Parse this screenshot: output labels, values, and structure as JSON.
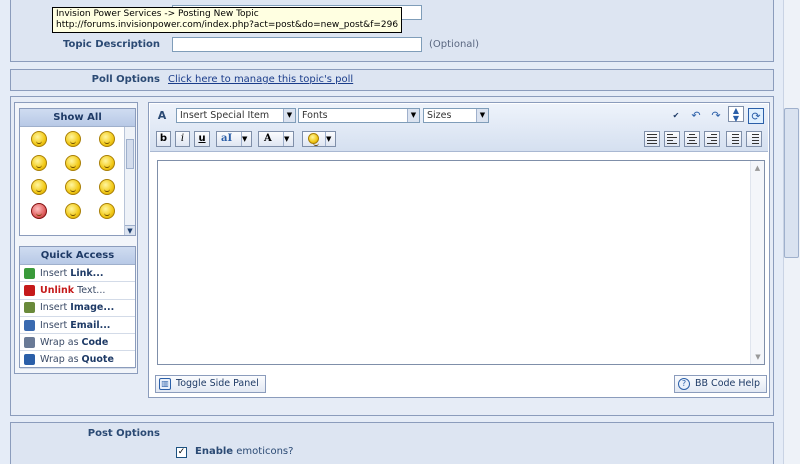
{
  "tooltip": {
    "title": "Invision Power Services -> Posting New Topic",
    "url": "http://forums.invisionpower.com/index.php?act=post&do=new_post&f=296"
  },
  "form": {
    "topic_description_label": "Topic Description",
    "topic_description_value": "",
    "optional_text": "(Optional)",
    "poll_label": "Poll Options",
    "poll_link": "Click here to manage this topic's poll"
  },
  "side_panel": {
    "emoticons_header": "Show All",
    "quick_access_header": "Quick Access",
    "quick_access": [
      {
        "prefix": "Insert ",
        "bold": "Link...",
        "suffix": "",
        "icon": "link-icon",
        "color": "#3a9a3a"
      },
      {
        "prefix": "",
        "bold": "Unlink",
        "suffix": " Text...",
        "icon": "unlink-icon",
        "color": "#c51a1a"
      },
      {
        "prefix": "Insert ",
        "bold": "Image...",
        "suffix": "",
        "icon": "image-icon",
        "color": "#6a8a3a"
      },
      {
        "prefix": "Insert ",
        "bold": "Email...",
        "suffix": "",
        "icon": "email-icon",
        "color": "#3a6ab0"
      },
      {
        "prefix": "Wrap as ",
        "bold": "Code",
        "suffix": "",
        "icon": "code-icon",
        "color": "#6a7a96"
      },
      {
        "prefix": "Wrap as ",
        "bold": "Quote",
        "suffix": "",
        "icon": "quote-icon",
        "color": "#2b5fa8"
      }
    ]
  },
  "toolbar": {
    "special_item": "Insert Special Item",
    "fonts": "Fonts",
    "sizes": "Sizes",
    "bold": "b",
    "italic": "i",
    "underline": "u",
    "font_color": "aI",
    "text_format": "A"
  },
  "buttons": {
    "toggle_side_panel": "Toggle Side Panel",
    "bb_code_help": "BB Code Help"
  },
  "post_options": {
    "label": "Post Options",
    "enable_bold": "Enable",
    "enable_rest": " emoticons?",
    "checked": true
  }
}
